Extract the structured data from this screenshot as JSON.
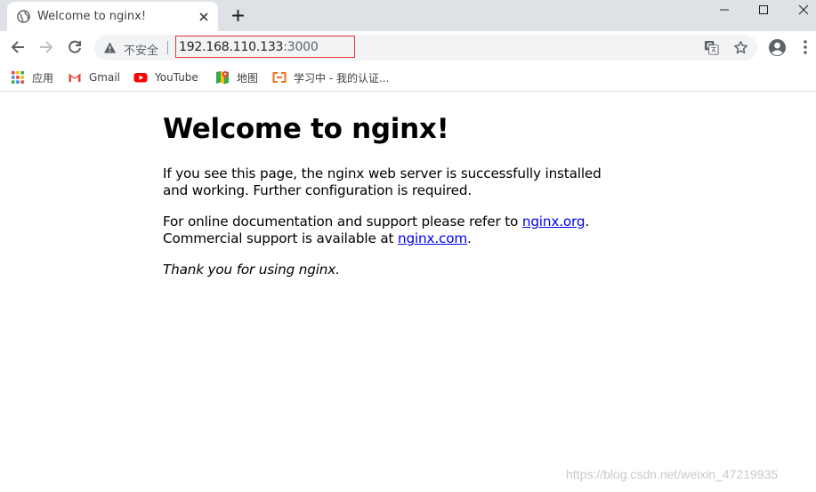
{
  "tab": {
    "title": "Welcome to nginx!"
  },
  "omnibox": {
    "security_label": "不安全",
    "url_host": "192.168.110.133",
    "url_port": ":3000"
  },
  "bookmarks": [
    {
      "label": "应用",
      "icon": "apps-grid-icon"
    },
    {
      "label": "Gmail",
      "icon": "gmail-icon"
    },
    {
      "label": "YouTube",
      "icon": "youtube-icon"
    },
    {
      "label": "地图",
      "icon": "maps-icon"
    },
    {
      "label": "学习中 - 我的认证...",
      "icon": "bookmark-site-icon"
    }
  ],
  "page": {
    "heading": "Welcome to nginx!",
    "para1": "If you see this page, the nginx web server is successfully installed and working. Further configuration is required.",
    "para2_prefix": "For online documentation and support please refer to ",
    "link_org": "nginx.org",
    "para2_mid": ".",
    "para2_line2": "Commercial support is available at ",
    "link_com": "nginx.com",
    "para2_end": ".",
    "thanks": "Thank you for using nginx."
  },
  "watermark": "https://blog.csdn.net/weixin_47219935",
  "colors": {
    "tabstrip": "#dee1e6",
    "omnibox": "#f1f3f4",
    "url_highlight": "#e53935",
    "link": "#0000ee"
  }
}
